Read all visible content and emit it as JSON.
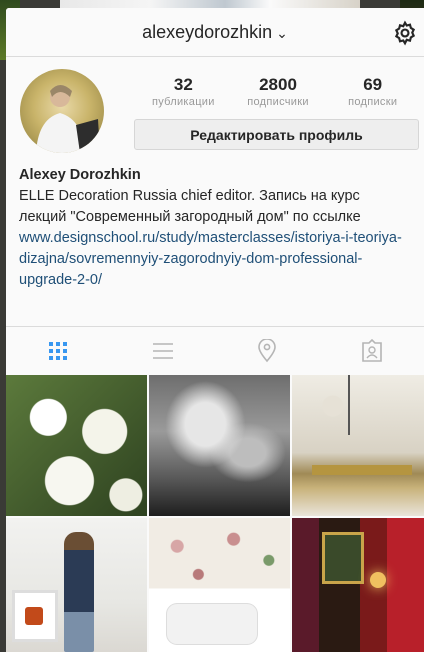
{
  "header": {
    "username": "alexeydorozhkin",
    "dropdown_icon": "chevron-down-icon",
    "settings_icon": "gear-icon"
  },
  "profile": {
    "stats": [
      {
        "value": "32",
        "label": "публикации"
      },
      {
        "value": "2800",
        "label": "подписчики"
      },
      {
        "value": "69",
        "label": "подписки"
      }
    ],
    "edit_button": "Редактировать профиль"
  },
  "bio": {
    "name": "Alexey Dorozhkin",
    "text": "ELLE Decoration Russia chief editor. Запись на курс лекций \"Современный загородный дом\" по ссылке",
    "link": "www.designschool.ru/study/masterclasses/istoriya-i-teoriya-dizajna/sovremennyiy-zagorodnyiy-dom-professional-upgrade-2-0/"
  },
  "tabs": [
    {
      "icon": "grid-icon",
      "active": true
    },
    {
      "icon": "list-icon",
      "active": false
    },
    {
      "icon": "location-pin-icon",
      "active": false
    },
    {
      "icon": "tagged-person-icon",
      "active": false
    }
  ],
  "colors": {
    "accent": "#3897f0",
    "link": "#1f4f77",
    "muted": "#999999"
  }
}
